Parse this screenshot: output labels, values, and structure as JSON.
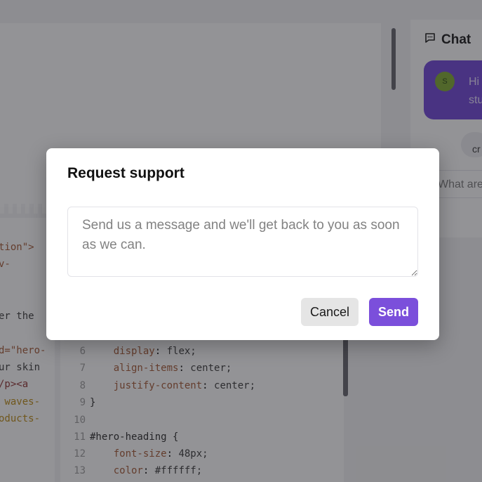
{
  "background": {
    "code_left_snippets": [
      "tion\">",
      "v-",
      "",
      "",
      "er the",
      "",
      "d=\"hero-",
      "ur skin",
      "/p><a",
      " waves-",
      "oducts-"
    ],
    "code_lines": [
      {
        "num": "6",
        "prop": "display",
        "val": "flex;"
      },
      {
        "num": "7",
        "prop": "align-items",
        "val": "center;"
      },
      {
        "num": "8",
        "prop": "justify-content",
        "val": "center;"
      },
      {
        "num": "9",
        "text": "}"
      },
      {
        "num": "10",
        "text": ""
      },
      {
        "num": "11",
        "text": "#hero-heading {"
      },
      {
        "num": "12",
        "prop": "font-size",
        "val": "48px;"
      },
      {
        "num": "13",
        "prop": "color",
        "val": "#ffffff;"
      }
    ],
    "chat": {
      "title": "Chat",
      "avatar_initial": "S",
      "bubble_text": "Hi\nstu",
      "pill_text": "cr",
      "input_placeholder": "What are"
    }
  },
  "modal": {
    "title": "Request support",
    "textarea_placeholder": "Send us a message and we'll get back to you as soon as we can.",
    "cancel_label": "Cancel",
    "send_label": "Send"
  },
  "colors": {
    "accent": "#7b4fdb",
    "chat_bubble": "#6b3fd6",
    "avatar": "#7aa629",
    "backdrop": "rgba(40,40,45,0.5)"
  },
  "icons": [
    "chat-bubble-icon"
  ]
}
